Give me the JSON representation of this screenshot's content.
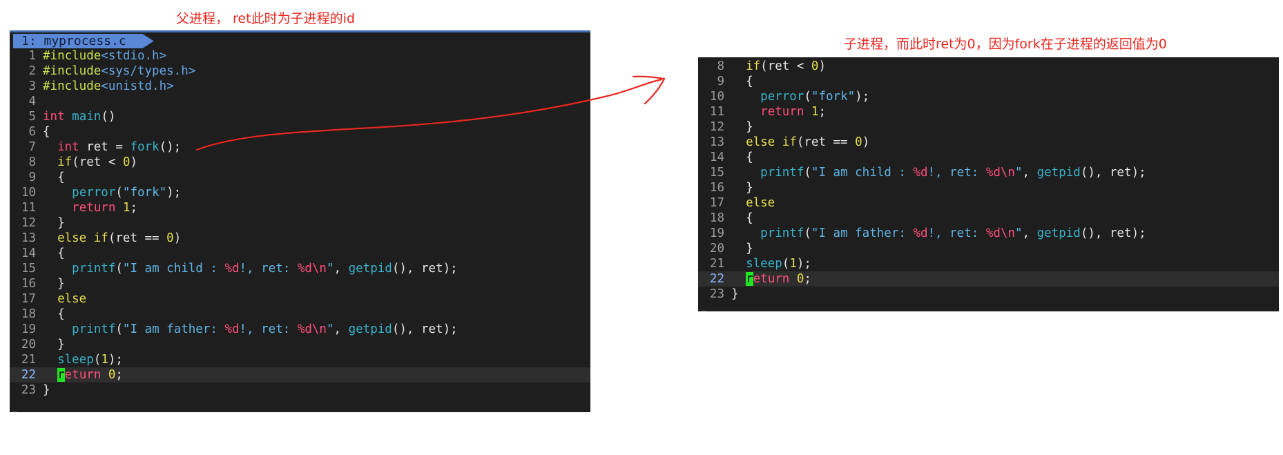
{
  "annotations": {
    "left_note": "父进程， ret此时为子进程的id",
    "right_note": "子进程，而此时ret为0，因为fork在子进程的返回值为0",
    "arrow_color": "#e8271f"
  },
  "left_editor": {
    "tab_label": "1: myprocess.c",
    "current_line": 22,
    "end_marker": "~",
    "lines": [
      {
        "n": "1",
        "tokens": [
          [
            "#include",
            "pre"
          ],
          [
            "<stdio.h>",
            "inc"
          ]
        ]
      },
      {
        "n": "2",
        "tokens": [
          [
            "#include",
            "pre"
          ],
          [
            "<sys/types.h>",
            "inc"
          ]
        ]
      },
      {
        "n": "3",
        "tokens": [
          [
            "#include",
            "pre"
          ],
          [
            "<unistd.h>",
            "inc"
          ]
        ]
      },
      {
        "n": "4",
        "tokens": []
      },
      {
        "n": "5",
        "tokens": [
          [
            "int",
            "type"
          ],
          [
            " ",
            "plain"
          ],
          [
            "main",
            "func"
          ],
          [
            "()",
            "plain"
          ]
        ]
      },
      {
        "n": "6",
        "tokens": [
          [
            "{",
            "plain"
          ]
        ]
      },
      {
        "n": "7",
        "tokens": [
          [
            "  ",
            "plain"
          ],
          [
            "int",
            "type"
          ],
          [
            " ret = ",
            "plain"
          ],
          [
            "fork",
            "func"
          ],
          [
            "();",
            "plain"
          ]
        ]
      },
      {
        "n": "8",
        "tokens": [
          [
            "  ",
            "plain"
          ],
          [
            "if",
            "kw"
          ],
          [
            "(ret < ",
            "plain"
          ],
          [
            "0",
            "num"
          ],
          [
            ")",
            "plain"
          ]
        ]
      },
      {
        "n": "9",
        "tokens": [
          [
            "  {",
            "plain"
          ]
        ]
      },
      {
        "n": "10",
        "tokens": [
          [
            "    ",
            "plain"
          ],
          [
            "perror",
            "func"
          ],
          [
            "(",
            "plain"
          ],
          [
            "\"fork\"",
            "str"
          ],
          [
            ");",
            "plain"
          ]
        ]
      },
      {
        "n": "11",
        "tokens": [
          [
            "    ",
            "plain"
          ],
          [
            "return",
            "type"
          ],
          [
            " ",
            "plain"
          ],
          [
            "1",
            "num"
          ],
          [
            ";",
            "plain"
          ]
        ]
      },
      {
        "n": "12",
        "tokens": [
          [
            "  }",
            "plain"
          ]
        ]
      },
      {
        "n": "13",
        "tokens": [
          [
            "  ",
            "plain"
          ],
          [
            "else if",
            "kw"
          ],
          [
            "(ret == ",
            "plain"
          ],
          [
            "0",
            "num"
          ],
          [
            ")",
            "plain"
          ]
        ]
      },
      {
        "n": "14",
        "tokens": [
          [
            "  {",
            "plain"
          ]
        ]
      },
      {
        "n": "15",
        "tokens": [
          [
            "    ",
            "plain"
          ],
          [
            "printf",
            "func"
          ],
          [
            "(",
            "plain"
          ],
          [
            "\"I am child : ",
            "str"
          ],
          [
            "%d",
            "fmt"
          ],
          [
            "!, ret: ",
            "str"
          ],
          [
            "%d",
            "fmt"
          ],
          [
            "\\n",
            "fmt"
          ],
          [
            "\"",
            "str"
          ],
          [
            ", ",
            "plain"
          ],
          [
            "getpid",
            "func"
          ],
          [
            "(), ret);",
            "plain"
          ]
        ]
      },
      {
        "n": "16",
        "tokens": [
          [
            "  }",
            "plain"
          ]
        ]
      },
      {
        "n": "17",
        "tokens": [
          [
            "  ",
            "plain"
          ],
          [
            "else",
            "kw"
          ]
        ]
      },
      {
        "n": "18",
        "tokens": [
          [
            "  {",
            "plain"
          ]
        ]
      },
      {
        "n": "19",
        "tokens": [
          [
            "    ",
            "plain"
          ],
          [
            "printf",
            "func"
          ],
          [
            "(",
            "plain"
          ],
          [
            "\"I am father: ",
            "str"
          ],
          [
            "%d",
            "fmt"
          ],
          [
            "!, ret: ",
            "str"
          ],
          [
            "%d",
            "fmt"
          ],
          [
            "\\n",
            "fmt"
          ],
          [
            "\"",
            "str"
          ],
          [
            ", ",
            "plain"
          ],
          [
            "getpid",
            "func"
          ],
          [
            "(), ret);",
            "plain"
          ]
        ]
      },
      {
        "n": "20",
        "tokens": [
          [
            "  }",
            "plain"
          ]
        ]
      },
      {
        "n": "21",
        "tokens": [
          [
            "  ",
            "plain"
          ],
          [
            "sleep",
            "func"
          ],
          [
            "(",
            "plain"
          ],
          [
            "1",
            "num"
          ],
          [
            ");",
            "plain"
          ]
        ]
      },
      {
        "n": "22",
        "tokens": [
          [
            "  ",
            "plain"
          ],
          [
            "r",
            "cursor"
          ],
          [
            "eturn",
            "type"
          ],
          [
            " ",
            "plain"
          ],
          [
            "0",
            "num"
          ],
          [
            ";",
            "plain"
          ]
        ]
      },
      {
        "n": "23",
        "tokens": [
          [
            "}",
            "plain"
          ]
        ]
      }
    ]
  },
  "right_editor": {
    "current_line": 22,
    "end_marker": "~",
    "lines": [
      {
        "n": "8",
        "tokens": [
          [
            "  ",
            "plain"
          ],
          [
            "if",
            "kw"
          ],
          [
            "(ret < ",
            "plain"
          ],
          [
            "0",
            "num"
          ],
          [
            ")",
            "plain"
          ]
        ]
      },
      {
        "n": "9",
        "tokens": [
          [
            "  {",
            "plain"
          ]
        ]
      },
      {
        "n": "10",
        "tokens": [
          [
            "    ",
            "plain"
          ],
          [
            "perror",
            "func"
          ],
          [
            "(",
            "plain"
          ],
          [
            "\"fork\"",
            "str"
          ],
          [
            ");",
            "plain"
          ]
        ]
      },
      {
        "n": "11",
        "tokens": [
          [
            "    ",
            "plain"
          ],
          [
            "return",
            "type"
          ],
          [
            " ",
            "plain"
          ],
          [
            "1",
            "num"
          ],
          [
            ";",
            "plain"
          ]
        ]
      },
      {
        "n": "12",
        "tokens": [
          [
            "  }",
            "plain"
          ]
        ]
      },
      {
        "n": "13",
        "tokens": [
          [
            "  ",
            "plain"
          ],
          [
            "else if",
            "kw"
          ],
          [
            "(ret == ",
            "plain"
          ],
          [
            "0",
            "num"
          ],
          [
            ")",
            "plain"
          ]
        ]
      },
      {
        "n": "14",
        "tokens": [
          [
            "  {",
            "plain"
          ]
        ]
      },
      {
        "n": "15",
        "tokens": [
          [
            "    ",
            "plain"
          ],
          [
            "printf",
            "func"
          ],
          [
            "(",
            "plain"
          ],
          [
            "\"I am child : ",
            "str"
          ],
          [
            "%d",
            "fmt"
          ],
          [
            "!, ret: ",
            "str"
          ],
          [
            "%d",
            "fmt"
          ],
          [
            "\\n",
            "fmt"
          ],
          [
            "\"",
            "str"
          ],
          [
            ", ",
            "plain"
          ],
          [
            "getpid",
            "func"
          ],
          [
            "(), ret);",
            "plain"
          ]
        ]
      },
      {
        "n": "16",
        "tokens": [
          [
            "  }",
            "plain"
          ]
        ]
      },
      {
        "n": "17",
        "tokens": [
          [
            "  ",
            "plain"
          ],
          [
            "else",
            "kw"
          ]
        ]
      },
      {
        "n": "18",
        "tokens": [
          [
            "  {",
            "plain"
          ]
        ]
      },
      {
        "n": "19",
        "tokens": [
          [
            "    ",
            "plain"
          ],
          [
            "printf",
            "func"
          ],
          [
            "(",
            "plain"
          ],
          [
            "\"I am father: ",
            "str"
          ],
          [
            "%d",
            "fmt"
          ],
          [
            "!, ret: ",
            "str"
          ],
          [
            "%d",
            "fmt"
          ],
          [
            "\\n",
            "fmt"
          ],
          [
            "\"",
            "str"
          ],
          [
            ", ",
            "plain"
          ],
          [
            "getpid",
            "func"
          ],
          [
            "(), ret);",
            "plain"
          ]
        ]
      },
      {
        "n": "20",
        "tokens": [
          [
            "  }",
            "plain"
          ]
        ]
      },
      {
        "n": "21",
        "tokens": [
          [
            "  ",
            "plain"
          ],
          [
            "sleep",
            "func"
          ],
          [
            "(",
            "plain"
          ],
          [
            "1",
            "num"
          ],
          [
            ");",
            "plain"
          ]
        ]
      },
      {
        "n": "22",
        "tokens": [
          [
            "  ",
            "plain"
          ],
          [
            "r",
            "cursor"
          ],
          [
            "eturn",
            "type"
          ],
          [
            " ",
            "plain"
          ],
          [
            "0",
            "num"
          ],
          [
            ";",
            "plain"
          ]
        ]
      },
      {
        "n": "23",
        "tokens": [
          [
            "}",
            "plain"
          ]
        ]
      }
    ]
  }
}
